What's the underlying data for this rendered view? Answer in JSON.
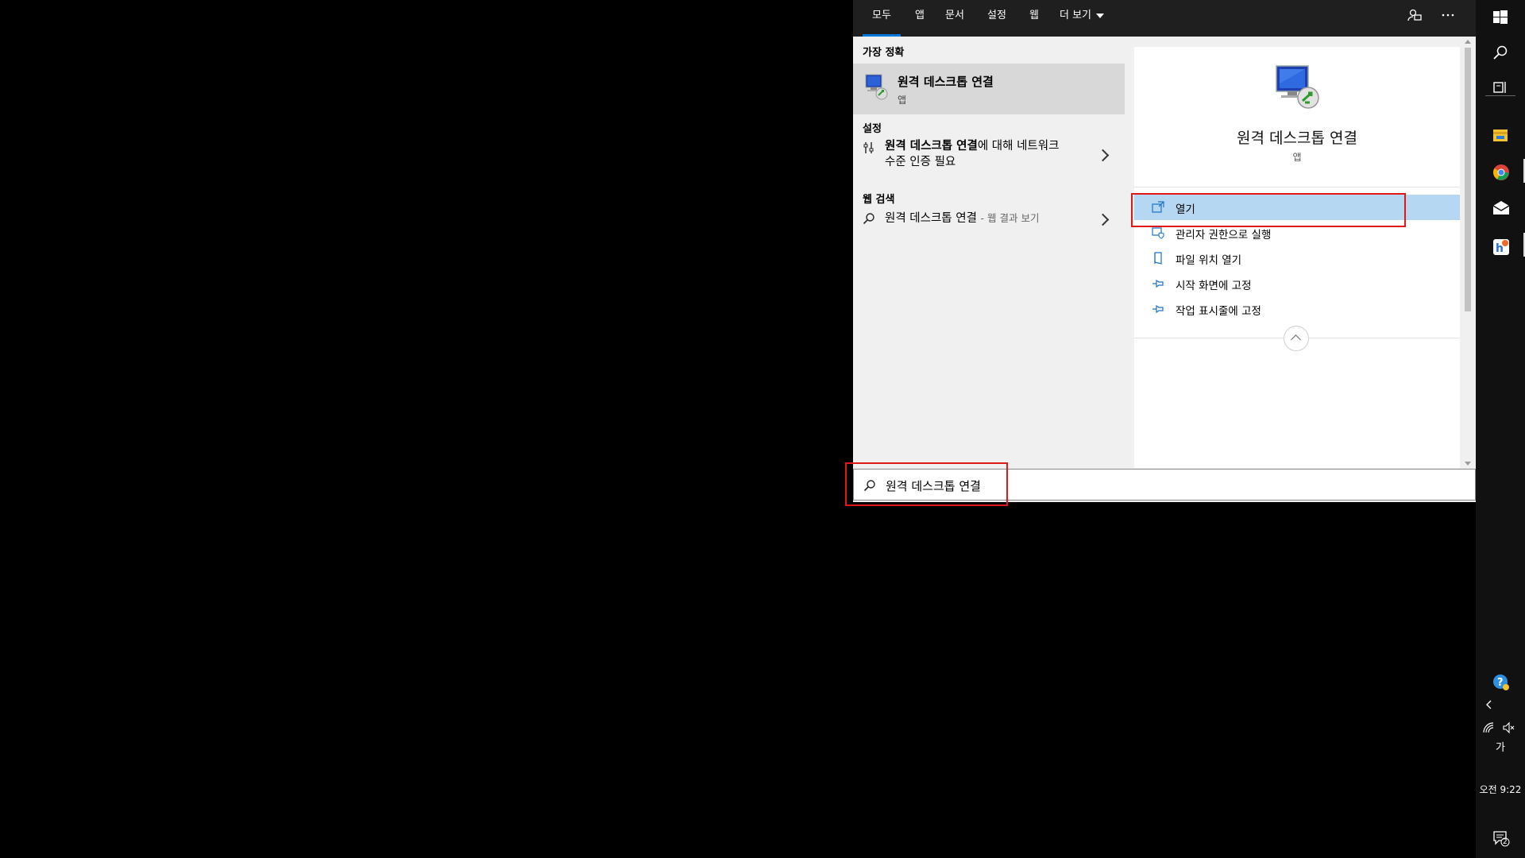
{
  "tabs": [
    {
      "label": "모두",
      "active": true
    },
    {
      "label": "앱"
    },
    {
      "label": "문서"
    },
    {
      "label": "설정"
    },
    {
      "label": "웹"
    },
    {
      "label": "더 보기"
    }
  ],
  "toolbar_icons": [
    "feedback-icon",
    "more-options-icon"
  ],
  "left": {
    "best_match_title": "가장 정확",
    "best_match": {
      "name": "원격 데스크톱 연결",
      "type": "앱",
      "icon": "remote-desktop-icon"
    },
    "settings_title": "설정",
    "settings_item": {
      "name_bold": "원격 데스크톱 연결",
      "name_rest_line1": "에 대해 네트워크",
      "name_line2": "수준 인증 필요",
      "icon": "settings-sliders-icon"
    },
    "web_title": "웹 검색",
    "web_item": {
      "query": "원격 데스크톱 연결",
      "suffix": "- 웹 결과 보기",
      "icon": "search-icon"
    }
  },
  "right": {
    "app_name": "원격 데스크톱 연결",
    "app_type": "앱",
    "actions": [
      {
        "label": "열기",
        "icon": "open-icon",
        "selected": true
      },
      {
        "label": "관리자 권한으로 실행",
        "icon": "run-as-admin-icon"
      },
      {
        "label": "파일 위치 열기",
        "icon": "file-location-icon"
      },
      {
        "label": "시작 화면에 고정",
        "icon": "pin-icon"
      },
      {
        "label": "작업 표시줄에 고정",
        "icon": "pin-icon"
      }
    ]
  },
  "search": {
    "value": "원격 데스크톱 연결",
    "icon": "search-icon"
  },
  "taskbar": {
    "top_icons": [
      "windows-start-icon",
      "search-icon",
      "task-view-icon"
    ],
    "pinned": [
      "file-explorer-icon",
      "chrome-icon",
      "mail-icon",
      "hancom-icon"
    ],
    "tray": {
      "help_icon": "help-icon",
      "expand_icon": "chevron-left-icon",
      "network_icon": "network-icon",
      "volume_icon": "volume-muted-icon",
      "ime": "가",
      "time": "오전 9:22",
      "notification_count": "2"
    }
  },
  "colors": {
    "accent": "#0078d7",
    "selected": "#b5d7f1",
    "highlight": "#e01818",
    "taskbar": "#111111"
  }
}
